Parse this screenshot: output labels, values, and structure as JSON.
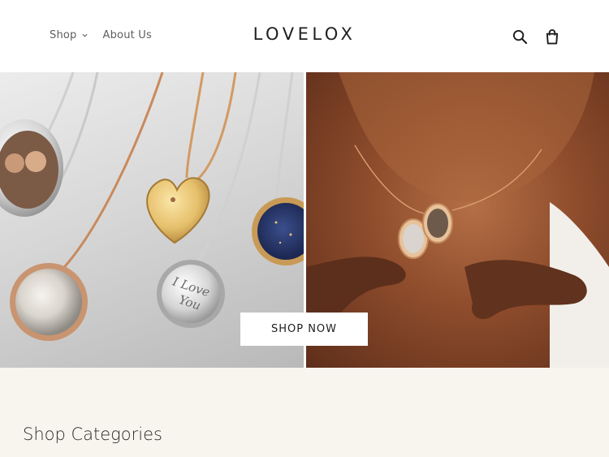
{
  "header": {
    "nav": [
      {
        "label": "Shop",
        "has_dropdown": true
      },
      {
        "label": "About Us",
        "has_dropdown": false
      }
    ],
    "logo": "LOVELOX",
    "icons": [
      "search-icon",
      "cart-icon"
    ]
  },
  "hero": {
    "left_image": "lockets-on-grey-surface",
    "right_image": "woman-holding-open-locket",
    "locket_engraving": "I Love You",
    "cta_label": "SHOP NOW"
  },
  "section": {
    "title": "Shop Categories"
  }
}
